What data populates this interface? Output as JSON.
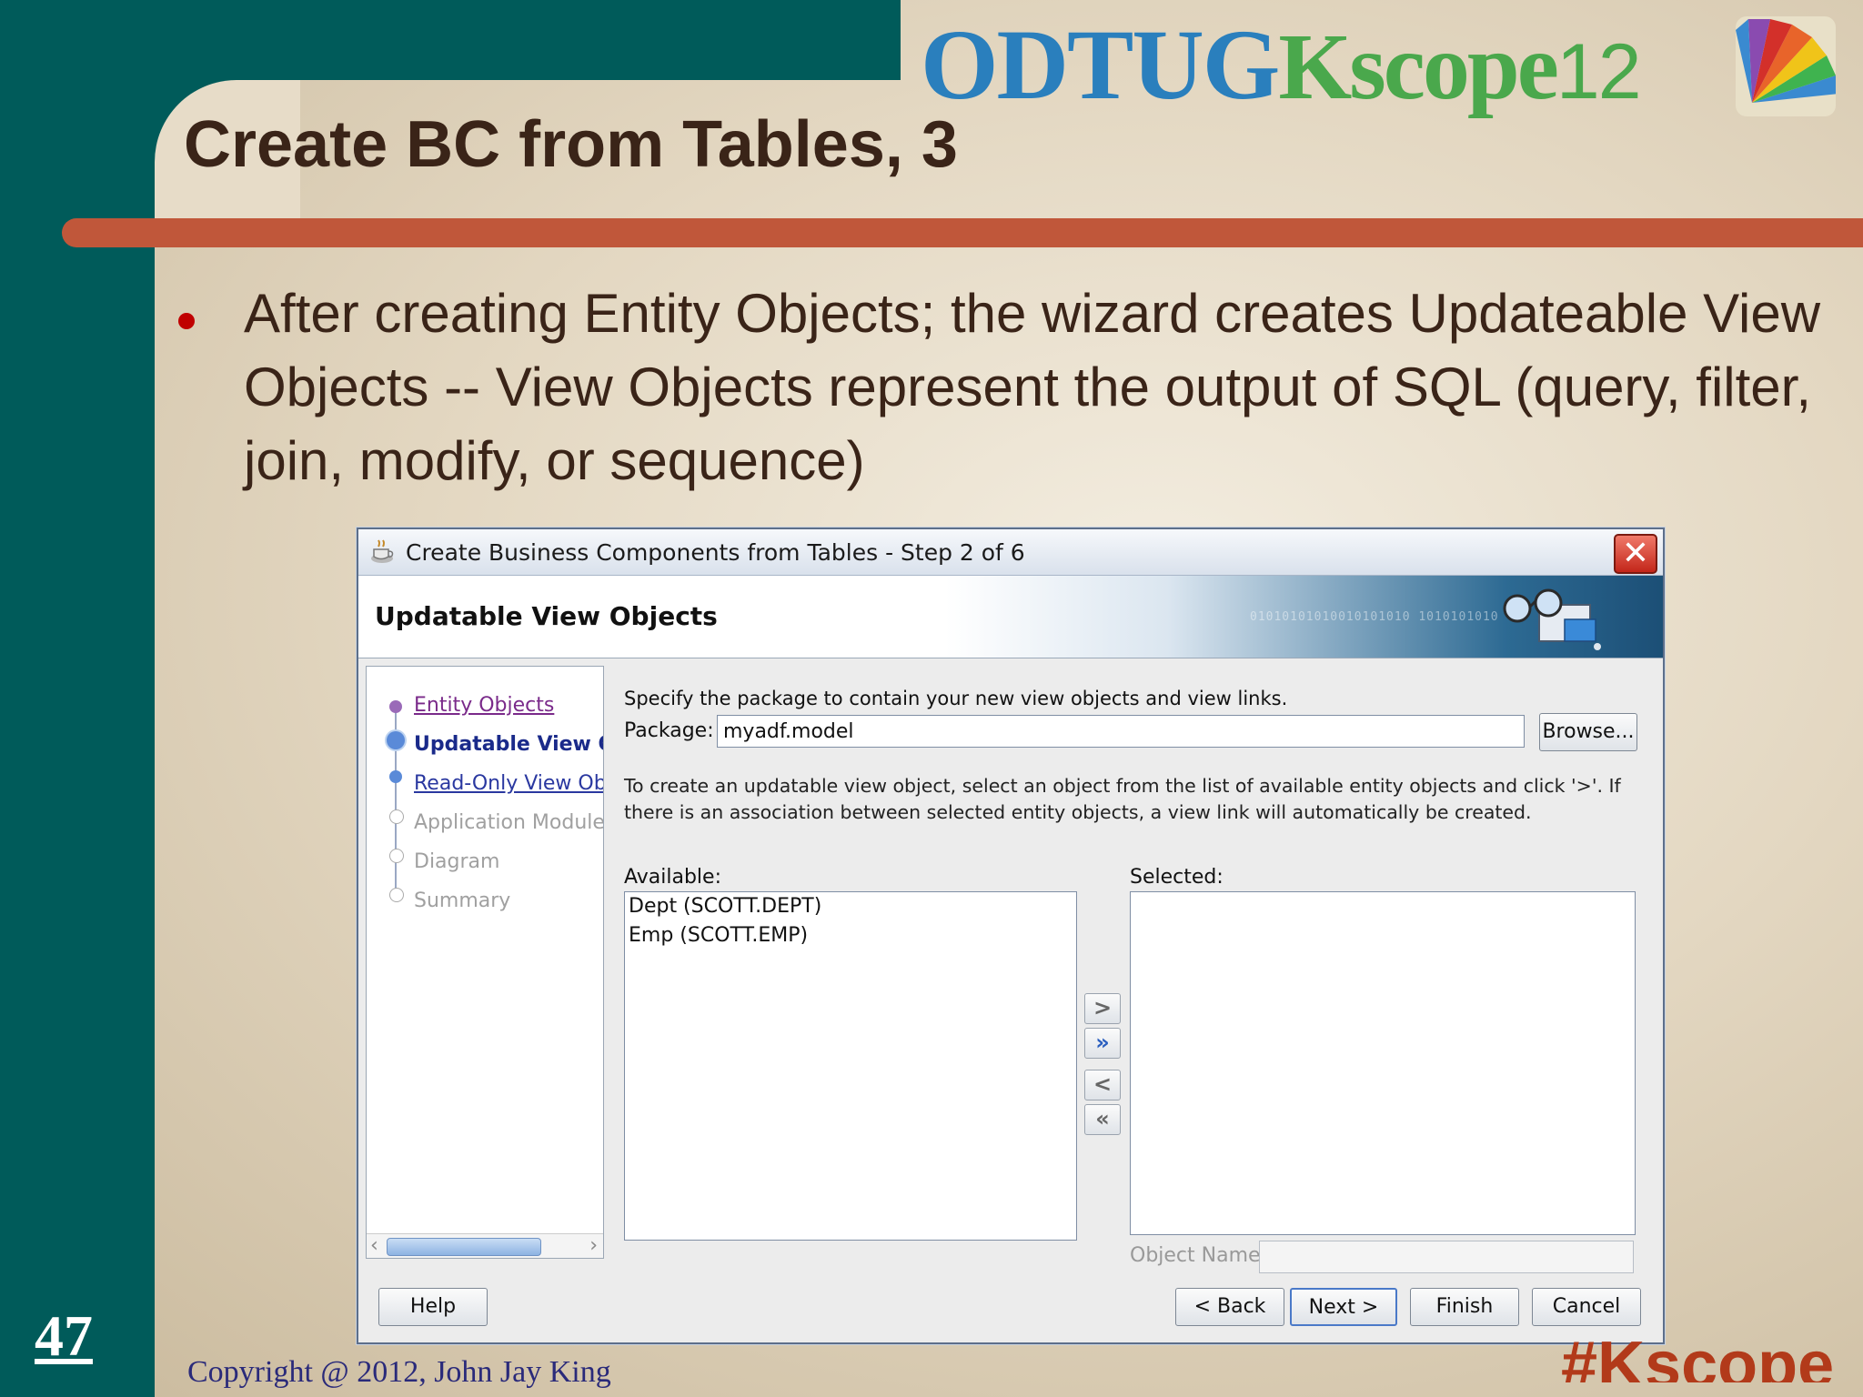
{
  "slide": {
    "title": "Create BC from Tables, 3",
    "bullet": "After creating Entity Objects; the wizard creates Updateable View Objects -- View Objects represent the output of SQL (query, filter, join, modify, or sequence)",
    "slide_number": "47",
    "copyright": "Copyright @ 2012, John Jay King",
    "hashtag": "#Kscope",
    "logo": {
      "part1": "ODTUG",
      "part2": "Kscope",
      "part3": "12"
    },
    "colors": {
      "teal": "#005b5a",
      "rule": "#c0573a",
      "text": "#3a2418"
    }
  },
  "dialog": {
    "title": "Create Business Components from Tables - Step 2 of 6",
    "banner_title": "Updatable View Objects",
    "banner_binary": "01010101010010101010 1010101010",
    "steps": [
      {
        "label": "Entity Objects",
        "state": "visited"
      },
      {
        "label": "Updatable View Ol",
        "state": "current"
      },
      {
        "label": "Read-Only View Obj",
        "state": "link"
      },
      {
        "label": "Application Module",
        "state": "disabled"
      },
      {
        "label": "Diagram",
        "state": "disabled"
      },
      {
        "label": "Summary",
        "state": "disabled"
      }
    ],
    "instruction": "Specify the package to contain your new view objects and view links.",
    "package_label": "Package:",
    "package_value": "myadf.model",
    "browse_label": "Browse...",
    "description": "To create an updatable view object, select an object from the list of available entity objects and click '>'.  If there is an association between selected entity objects, a view link will automatically be created.",
    "available_label": "Available:",
    "available_items": [
      "Dept (SCOTT.DEPT)",
      "Emp (SCOTT.EMP)"
    ],
    "selected_label": "Selected:",
    "selected_items": [],
    "shuttle": {
      "add": ">",
      "add_all": "»",
      "remove": "<",
      "remove_all": "«"
    },
    "object_name_label": "Object Name:",
    "object_name_value": "",
    "buttons": {
      "help": "Help",
      "back": "< Back",
      "next": "Next >",
      "finish": "Finish",
      "cancel": "Cancel"
    }
  }
}
